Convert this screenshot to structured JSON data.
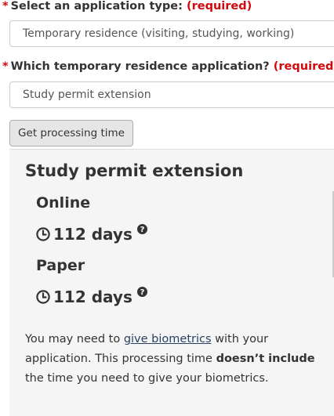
{
  "form": {
    "app_type": {
      "label": "Select an application type:",
      "required": "(required)",
      "value": "Temporary residence (visiting, studying, working)"
    },
    "temp_app": {
      "label": "Which temporary residence application?",
      "required": "(required)",
      "value": "Study permit extension"
    },
    "submit_label": "Get processing time"
  },
  "result": {
    "title": "Study permit extension",
    "online": {
      "label": "Online",
      "time": "112 days"
    },
    "paper": {
      "label": "Paper",
      "time": "112 days"
    },
    "note": {
      "part1": "You may need to ",
      "link": "give biometrics",
      "part2": " with your application. This processing time ",
      "bold": "doesn’t include",
      "part3": " the time you need to give your biometrics."
    }
  },
  "colors": {
    "required": "#d3080c",
    "link": "#284162",
    "panel_bg": "#f5f5f5",
    "button_bg": "#e6e6e6"
  },
  "icons": [
    "clock-icon",
    "question-circle-icon"
  ]
}
